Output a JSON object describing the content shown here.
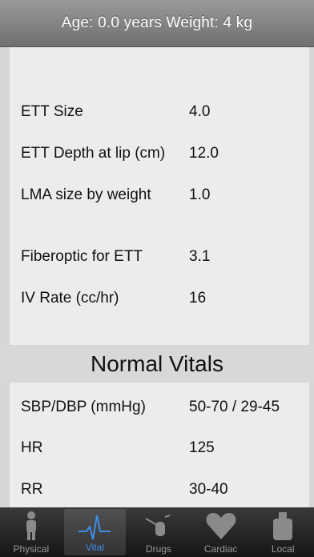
{
  "header": {
    "title": "Age: 0.0 years  Weight: 4 kg"
  },
  "airway": [
    {
      "label": "ETT Size",
      "value": "4.0"
    },
    {
      "label": "ETT Depth at lip (cm)",
      "value": "12.0"
    },
    {
      "label": "LMA size by weight",
      "value": "1.0"
    },
    {
      "label": "Fiberoptic for ETT",
      "value": "3.1"
    },
    {
      "label": "IV Rate (cc/hr)",
      "value": "16"
    }
  ],
  "vitals_section": {
    "title": "Normal Vitals"
  },
  "vitals": [
    {
      "label": "SBP/DBP (mmHg)",
      "value": "50-70 / 29-45"
    },
    {
      "label": "HR",
      "value": "125"
    },
    {
      "label": "RR",
      "value": "30-40"
    }
  ],
  "tabs": [
    {
      "label": "Physical",
      "icon": "person-icon",
      "active": false
    },
    {
      "label": "Vital",
      "icon": "heartbeat-icon",
      "active": true
    },
    {
      "label": "Drugs",
      "icon": "syringe-icon",
      "active": false
    },
    {
      "label": "Cardiac",
      "icon": "heart-icon",
      "active": false
    },
    {
      "label": "Local",
      "icon": "bottle-icon",
      "active": false
    }
  ],
  "colors": {
    "active_tab": "#3e8ee8",
    "inactive_tab": "#9a9a9a",
    "header": "#7f7f7f"
  }
}
